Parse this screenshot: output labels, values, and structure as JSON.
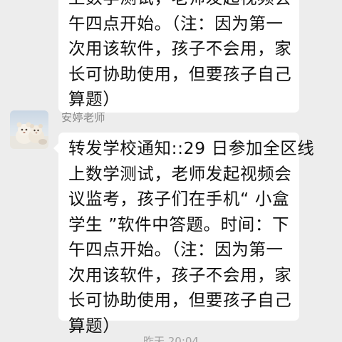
{
  "messages": {
    "top": {
      "lines": [
        "上数学测试，老师发起视频会",
        "午四点开始。（注：因为第一",
        "次用该软件，孩子不会用，家",
        "长可协助使用，但要孩子自己",
        "算题）"
      ]
    },
    "main": {
      "sender": "安婷老师",
      "avatar_icon": "fluffy-toy-avatar-icon",
      "lines": [
        "转发学校通知::29 日参加全区线",
        "上数学测试，老师发起视频会",
        "议监考，孩子们在手机“ 小盒",
        "学生 ”软件中答题。时间：下",
        "午四点开始。（注：因为第一",
        "次用该软件，孩子不会用，家",
        "长可协助使用，但要孩子自己",
        "算题）"
      ]
    }
  },
  "timestamp": "昨天 20:04",
  "colors": {
    "background": "#ededed",
    "bubble": "#ffffff",
    "text": "#111111",
    "sender": "#8a8a8a"
  }
}
